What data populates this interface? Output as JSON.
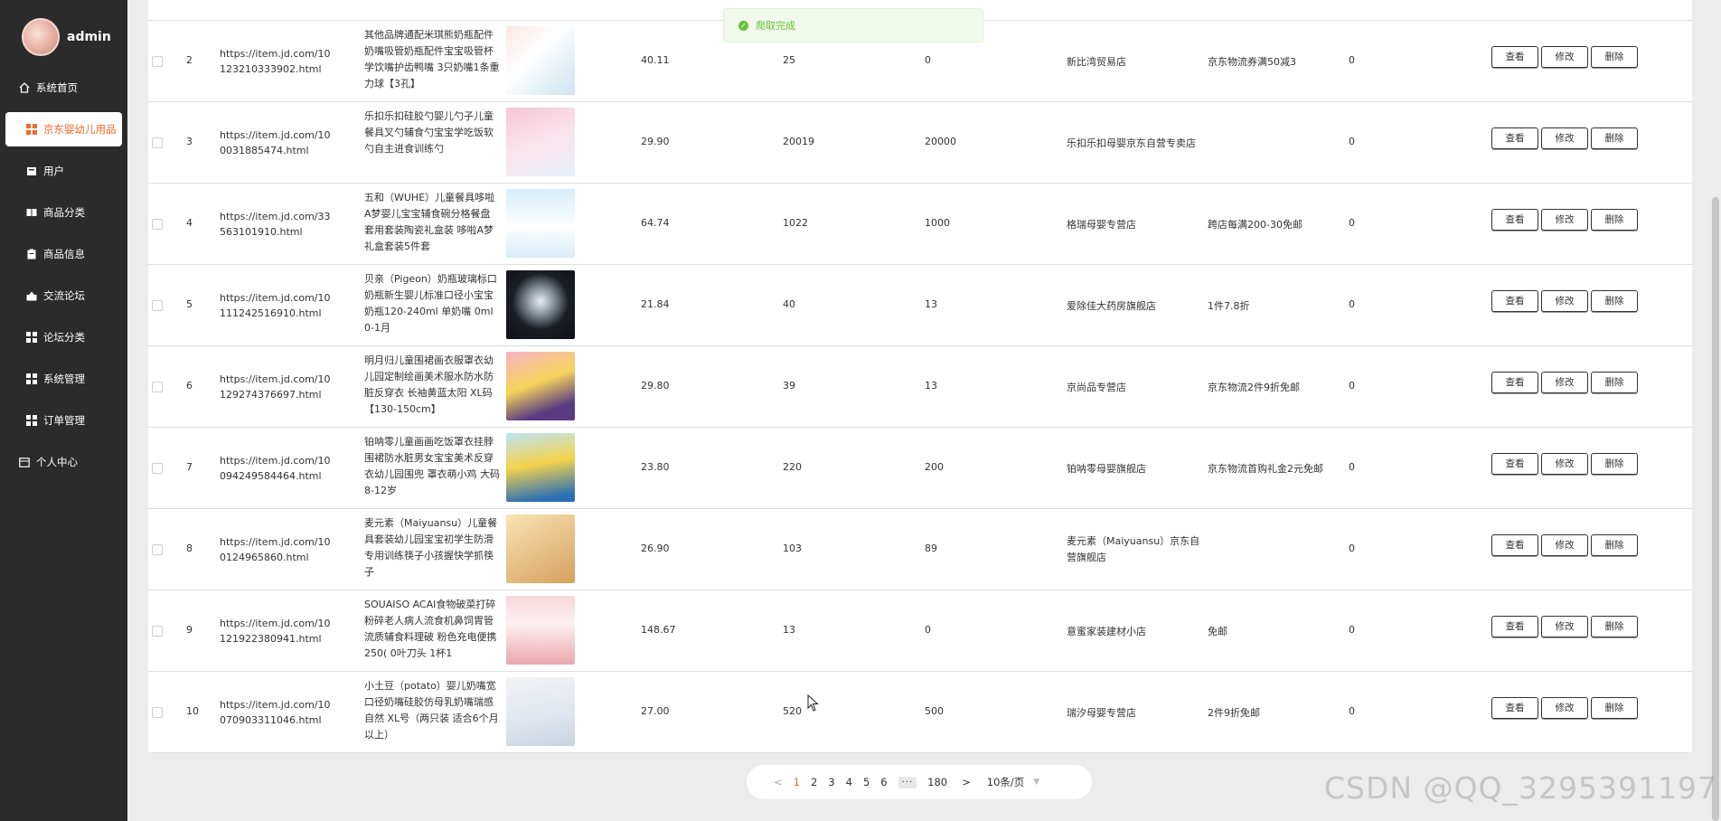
{
  "sidebar": {
    "username": "admin",
    "items": [
      {
        "label": "系统首页",
        "icon": "home-icon"
      },
      {
        "label": "京东婴幼儿用品",
        "icon": "grid-icon",
        "active": true
      },
      {
        "label": "用户",
        "icon": "user-card-icon"
      },
      {
        "label": "商品分类",
        "icon": "category-icon"
      },
      {
        "label": "商品信息",
        "icon": "clipboard-icon"
      },
      {
        "label": "交流论坛",
        "icon": "forum-icon"
      },
      {
        "label": "论坛分类",
        "icon": "grid-icon"
      },
      {
        "label": "系统管理",
        "icon": "grid-icon"
      },
      {
        "label": "订单管理",
        "icon": "grid-icon"
      },
      {
        "label": "个人中心",
        "icon": "profile-icon"
      }
    ]
  },
  "toast": {
    "text": "爬取完成",
    "color": "#67c23a"
  },
  "actions": {
    "view": "查看",
    "edit": "修改",
    "delete": "删除"
  },
  "rows": [
    {
      "index": "2",
      "url": "https://item.jd.com/10123210333902.html",
      "name": "其他品牌通配米琪熊奶瓶配件奶嘴吸管奶瓶配件宝宝吸管杯学饮嘴护齿鸭嘴 3只奶嘴1条重力球【3孔】",
      "price": "40.11",
      "n1": "25",
      "n2": "0",
      "shop": "新比湾贸易店",
      "shipping": "京东物流券满50减3",
      "count": "0"
    },
    {
      "index": "3",
      "url": "https://item.jd.com/100031885474.html",
      "name": "乐扣乐扣硅胶勺婴儿勺子儿童餐具叉勺辅食勺宝宝学吃饭软勺自主进食训练勺",
      "price": "29.90",
      "n1": "20019",
      "n2": "20000",
      "shop": "乐扣乐扣母婴京东自营专卖店",
      "shipping": "",
      "count": "0"
    },
    {
      "index": "4",
      "url": "https://item.jd.com/33563101910.html",
      "name": "五和（WUHE）儿童餐具哆啦A梦婴儿宝宝辅食碗分格餐盘套用套装陶瓷礼盒装 哆啦A梦礼盒套装5件套",
      "price": "64.74",
      "n1": "1022",
      "n2": "1000",
      "shop": "格瑞母婴专营店",
      "shipping": "跨店每满200-30免邮",
      "count": "0"
    },
    {
      "index": "5",
      "url": "https://item.jd.com/10111242516910.html",
      "name": "贝亲（Pigeon）奶瓶玻璃标口奶瓶新生婴儿标准口径小宝宝奶瓶120-240ml 单奶嘴 0ml 0-1月",
      "price": "21.84",
      "n1": "40",
      "n2": "13",
      "shop": "爱除佳大药房旗舰店",
      "shipping": "1件7.8折",
      "count": "0"
    },
    {
      "index": "6",
      "url": "https://item.jd.com/10129274376697.html",
      "name": "明月归儿童围裙画衣服罩衣幼儿园定制绘画美术服水防水防脏反穿衣 长袖黄蓝太阳 XL码【130-150cm】",
      "price": "29.80",
      "n1": "39",
      "n2": "13",
      "shop": "京尚品专营店",
      "shipping": "京东物流2件9折免邮",
      "count": "0"
    },
    {
      "index": "7",
      "url": "https://item.jd.com/10094249584464.html",
      "name": "铂呐零儿童画画吃饭罩衣挂脖围裙防水脏男女宝宝美术反穿衣幼儿园围兜 罩衣萌小鸡 大码8-12岁",
      "price": "23.80",
      "n1": "220",
      "n2": "200",
      "shop": "铂呐零母婴旗舰店",
      "shipping": "京东物流首购礼金2元免邮",
      "count": "0"
    },
    {
      "index": "8",
      "url": "https://item.jd.com/100124965860.html",
      "name": "麦元素（Maiyuansu）儿童餐具套装幼儿园宝宝初学生防滑专用训练筷子小孩握快学抓筷子",
      "price": "26.90",
      "n1": "103",
      "n2": "89",
      "shop": "麦元素（Maiyuansu）京东自营旗舰店",
      "shipping": "",
      "count": "0"
    },
    {
      "index": "9",
      "url": "https://item.jd.com/10121922380941.html",
      "name": "SOUAISO ACAI食物破菜打碎粉碎老人病人流食机鼻饲胃管流质辅食料理破 粉色充电便携250( 0叶刀头 1杯1",
      "price": "148.67",
      "n1": "13",
      "n2": "0",
      "shop": "意蜜家装建材小店",
      "shipping": "免邮",
      "count": "0"
    },
    {
      "index": "10",
      "url": "https://item.jd.com/10070903311046.html",
      "name": "小土豆（potato）婴儿奶嘴宽口径奶嘴硅胶仿母乳奶嘴瑞感自然 XL号（两只装 适合6个月以上）",
      "price": "27.00",
      "n1": "520",
      "n2": "500",
      "shop": "瑞汐母婴专营店",
      "shipping": "2件9折免邮",
      "count": "0"
    }
  ],
  "pagination": {
    "prev": "<",
    "pages": [
      "1",
      "2",
      "3",
      "4",
      "5",
      "6"
    ],
    "active": "1",
    "ellipsis": "···",
    "last": "180",
    "next": ">",
    "page_size": "10条/页"
  },
  "watermark": "CSDN @QQ_3295391197"
}
